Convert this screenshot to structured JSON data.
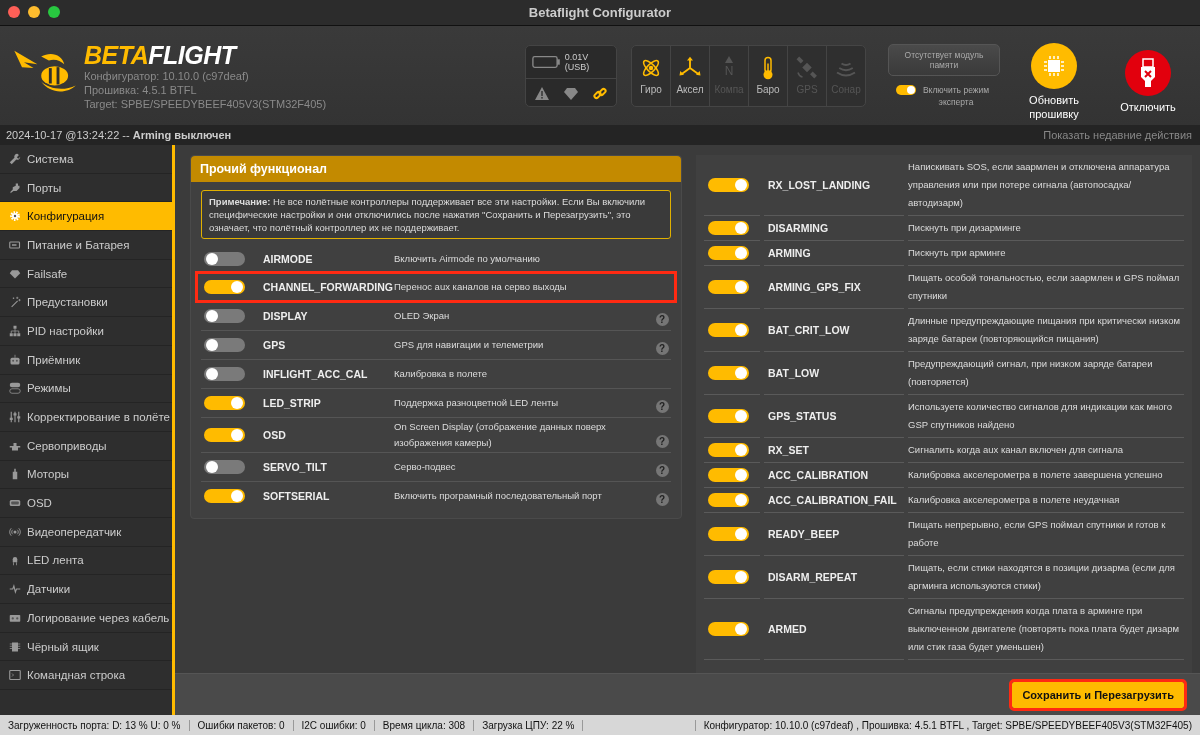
{
  "window": {
    "title": "Betaflight Configurator"
  },
  "header": {
    "logo": {
      "part1": "BETA",
      "part2": "FLIGHT"
    },
    "info": [
      "Конфигуратор: 10.10.0 (c97deaf)",
      "Прошивка: 4.5.1 BTFL",
      "Target: SPBE/SPEEDYBEEF405V3(STM32F405)"
    ],
    "battery": {
      "reading": "0.01V (USB)"
    },
    "sensors": [
      {
        "label": "Гиро",
        "active": true
      },
      {
        "label": "Аксел",
        "active": true
      },
      {
        "label": "Компа",
        "active": false,
        "glyph": "N"
      },
      {
        "label": "Баро",
        "active": true
      },
      {
        "label": "GPS",
        "active": false
      },
      {
        "label": "Сонар",
        "active": false
      }
    ],
    "memory_button": "Отсутствует модуль памяти",
    "expert_mode": {
      "label": "Включить режим эксперта",
      "on": true
    },
    "flash_button": "Обновить прошивку",
    "disconnect_button": "Отключить"
  },
  "log": {
    "text": "2024-10-17 @13:24:22 -- **Arming выключен**",
    "link": "Показать недавние действия"
  },
  "sidebar": {
    "items": [
      {
        "label": "Система",
        "selected": false
      },
      {
        "label": "Порты",
        "selected": false
      },
      {
        "label": "Конфигурация",
        "selected": true
      },
      {
        "label": "Питание и Батарея",
        "selected": false
      },
      {
        "label": "Failsafe",
        "selected": false
      },
      {
        "label": "Предустановки",
        "selected": false
      },
      {
        "label": "PID настройки",
        "selected": false
      },
      {
        "label": "Приёмник",
        "selected": false
      },
      {
        "label": "Режимы",
        "selected": false
      },
      {
        "label": "Корректирование в полёте",
        "selected": false
      },
      {
        "label": "Сервоприводы",
        "selected": false
      },
      {
        "label": "Моторы",
        "selected": false
      },
      {
        "label": "OSD",
        "selected": false
      },
      {
        "label": "Видеопередатчик",
        "selected": false
      },
      {
        "label": "LED лента",
        "selected": false
      },
      {
        "label": "Датчики",
        "selected": false
      },
      {
        "label": "Логирование через кабель",
        "selected": false
      },
      {
        "label": "Чёрный ящик",
        "selected": false
      },
      {
        "label": "Командная строка",
        "selected": false
      }
    ]
  },
  "features_panel": {
    "title": "Прочий функционал",
    "note": "**Примечание:** Не все полётные контроллеры поддерживает все эти настройки. Если Вы включили специфические настройки и они отключились после нажатия \"Сохранить и Перезагрузить\", это означает, что полётный контроллер их не поддерживает.",
    "features": [
      {
        "name": "AIRMODE",
        "description": "Включить Airmode по умолчанию",
        "on": false,
        "highlighted": false
      },
      {
        "name": "CHANNEL_FORWARDING",
        "description": "Перенос aux каналов на серво выходы",
        "on": true,
        "highlighted": true
      },
      {
        "name": "DISPLAY",
        "description": "OLED Экран",
        "on": false,
        "highlighted": false,
        "help": "?"
      },
      {
        "name": "GPS",
        "description": "GPS для навигации и телеметрии",
        "on": false,
        "highlighted": false,
        "help": "?"
      },
      {
        "name": "INFLIGHT_ACC_CAL",
        "description": "Калибровка в полете",
        "on": false,
        "highlighted": false
      },
      {
        "name": "LED_STRIP",
        "description": "Поддержка разноцветной LED ленты",
        "on": true,
        "highlighted": false,
        "help": "?"
      },
      {
        "name": "OSD",
        "description": "On Screen Display (отображение данных поверх изображения камеры)",
        "on": true,
        "highlighted": false,
        "help": "?"
      },
      {
        "name": "SERVO_TILT",
        "description": "Серво-подвес",
        "on": false,
        "highlighted": false,
        "help": "?"
      },
      {
        "name": "SOFTSERIAL",
        "description": "Включить програмный последовательный порт",
        "on": true,
        "highlighted": false,
        "help": "?"
      }
    ]
  },
  "beeper_panel": {
    "beepers": [
      {
        "name": "RX_LOST_LANDING",
        "description": "Напискивать SOS, если заармлен и отключена аппаратура управления или при потере сигнала (автопосадка/ автодизарм)",
        "on": true
      },
      {
        "name": "DISARMING",
        "description": "Пискнуть при дизарминге",
        "on": true
      },
      {
        "name": "ARMING",
        "description": "Пискнуть при арминге",
        "on": true
      },
      {
        "name": "ARMING_GPS_FIX",
        "description": "Пищать особой тональностью, если заармлен и GPS поймал спутники",
        "on": true
      },
      {
        "name": "BAT_CRIT_LOW",
        "description": "Длинные предупреждающие пищания при критически низком заряде батареи (повторяющийся пищания)",
        "on": true
      },
      {
        "name": "BAT_LOW",
        "description": "Предупреждающий сигнал, при низком заряде батареи (повторяется)",
        "on": true
      },
      {
        "name": "GPS_STATUS",
        "description": "Используете количество сигналов для индикации как много GSP спутников найдено",
        "on": true
      },
      {
        "name": "RX_SET",
        "description": "Сигналить когда aux канал включен для сигнала",
        "on": true
      },
      {
        "name": "ACC_CALIBRATION",
        "description": "Калибровка акселерометра в полете завершена успешно",
        "on": true
      },
      {
        "name": "ACC_CALIBRATION_FAIL",
        "description": "Калибровка акселерометра в полете неудачная",
        "on": true
      },
      {
        "name": "READY_BEEP",
        "description": "Пищать непрерывно, если GPS поймал спутники и готов к работе",
        "on": true
      },
      {
        "name": "DISARM_REPEAT",
        "description": "Пищать, если стики находятся в позиции дизарма (если для аргминга используются стики)",
        "on": true
      },
      {
        "name": "ARMED",
        "description": "Сигналы предупреждения когда плата в арминге при выключенном двигателе (повторять пока плата будет дизарм или стик газа будет уменьшен)",
        "on": true
      }
    ]
  },
  "save_button": {
    "label": "Сохранить и Перезагрузить",
    "highlighted": true
  },
  "status_bar": {
    "items": [
      "Загруженность порта: D: 13 % U: 0 %",
      "Ошибки пакетов: 0",
      "I2C ошибки: 0",
      "Время цикла: 308",
      "Загрузка ЦПУ: 22 %"
    ],
    "version": "Конфигуратор: 10.10.0 (c97deaf) , Прошивка: 4.5.1 BTFL , Target: SPBE/SPEEDYBEEF405V3(STM32F405)"
  }
}
